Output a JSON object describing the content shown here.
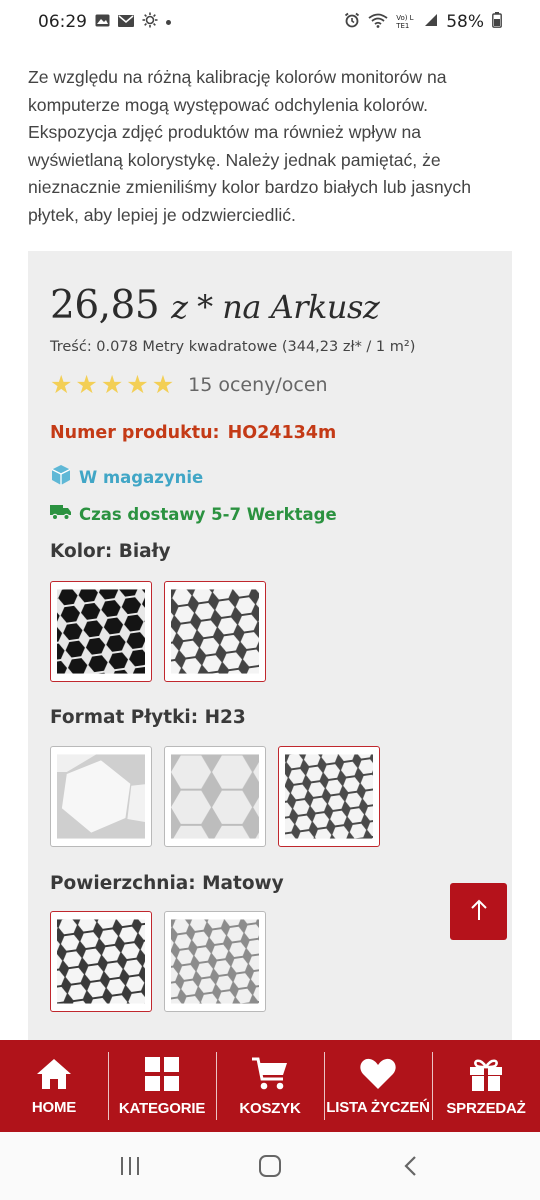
{
  "status_bar": {
    "time": "06:29",
    "battery": "58%",
    "network": "Vo) LTE1"
  },
  "intro": {
    "text": "Ze względu na różną kalibrację kolorów monitorów na komputerze mogą występować odchylenia kolorów. Ekspozycja zdjęć produktów ma również wpływ na wyświetlaną kolorystykę. Należy jednak pamiętać, że nieznacznie zmieniliśmy kolor bardzo białych lub jasnych płytek, aby lepiej je odzwierciedlić."
  },
  "product": {
    "price": "26,85",
    "price_suffix": "z * na Arkusz",
    "content_line": "Treść: 0.078 Metry kwadratowe (344,23 zł* / 1 m²)",
    "rating": {
      "stars": 5,
      "count_label": "15 oceny/ocen"
    },
    "product_number_label": "Numer produktu:",
    "product_number": "HO24134m",
    "stock": "W magazynie",
    "delivery": "Czas dostawy 5-7 Werktage"
  },
  "options": {
    "color": {
      "label": "Kolor: Biały",
      "swatches": [
        {
          "name": "black-hexagon",
          "selected": true
        },
        {
          "name": "white-hexagon",
          "selected": true
        }
      ]
    },
    "format": {
      "label": "Format Płytki: H23",
      "swatches": [
        {
          "name": "large-hexagon",
          "selected": false
        },
        {
          "name": "medium-hexagon",
          "selected": false
        },
        {
          "name": "small-hexagon",
          "selected": true
        }
      ]
    },
    "surface": {
      "label": "Powierzchnia: Matowy",
      "swatches": [
        {
          "name": "matte-hexagon",
          "selected": true
        },
        {
          "name": "glossy-hexagon",
          "selected": false
        }
      ]
    }
  },
  "scroll_top": {
    "icon": "arrow-up-icon"
  },
  "bottom_nav": {
    "items": [
      {
        "label": "HOME",
        "icon": "home-icon"
      },
      {
        "label": "KATEGORIE",
        "icon": "grid-icon"
      },
      {
        "label": "KOSZYK",
        "icon": "cart-icon"
      },
      {
        "label": "LISTA ŻYCZEŃ",
        "icon": "heart-icon"
      },
      {
        "label": "SPRZEDAŻ",
        "icon": "gift-icon"
      }
    ]
  },
  "system_nav": {
    "icons": [
      "recents-icon",
      "home-circle-icon",
      "back-icon"
    ]
  },
  "colors": {
    "brand_red": "#b0131a",
    "product_number": "#c43a16",
    "stock_blue": "#41a6c6",
    "delivery_green": "#2b9240",
    "star": "#f3cf56"
  }
}
